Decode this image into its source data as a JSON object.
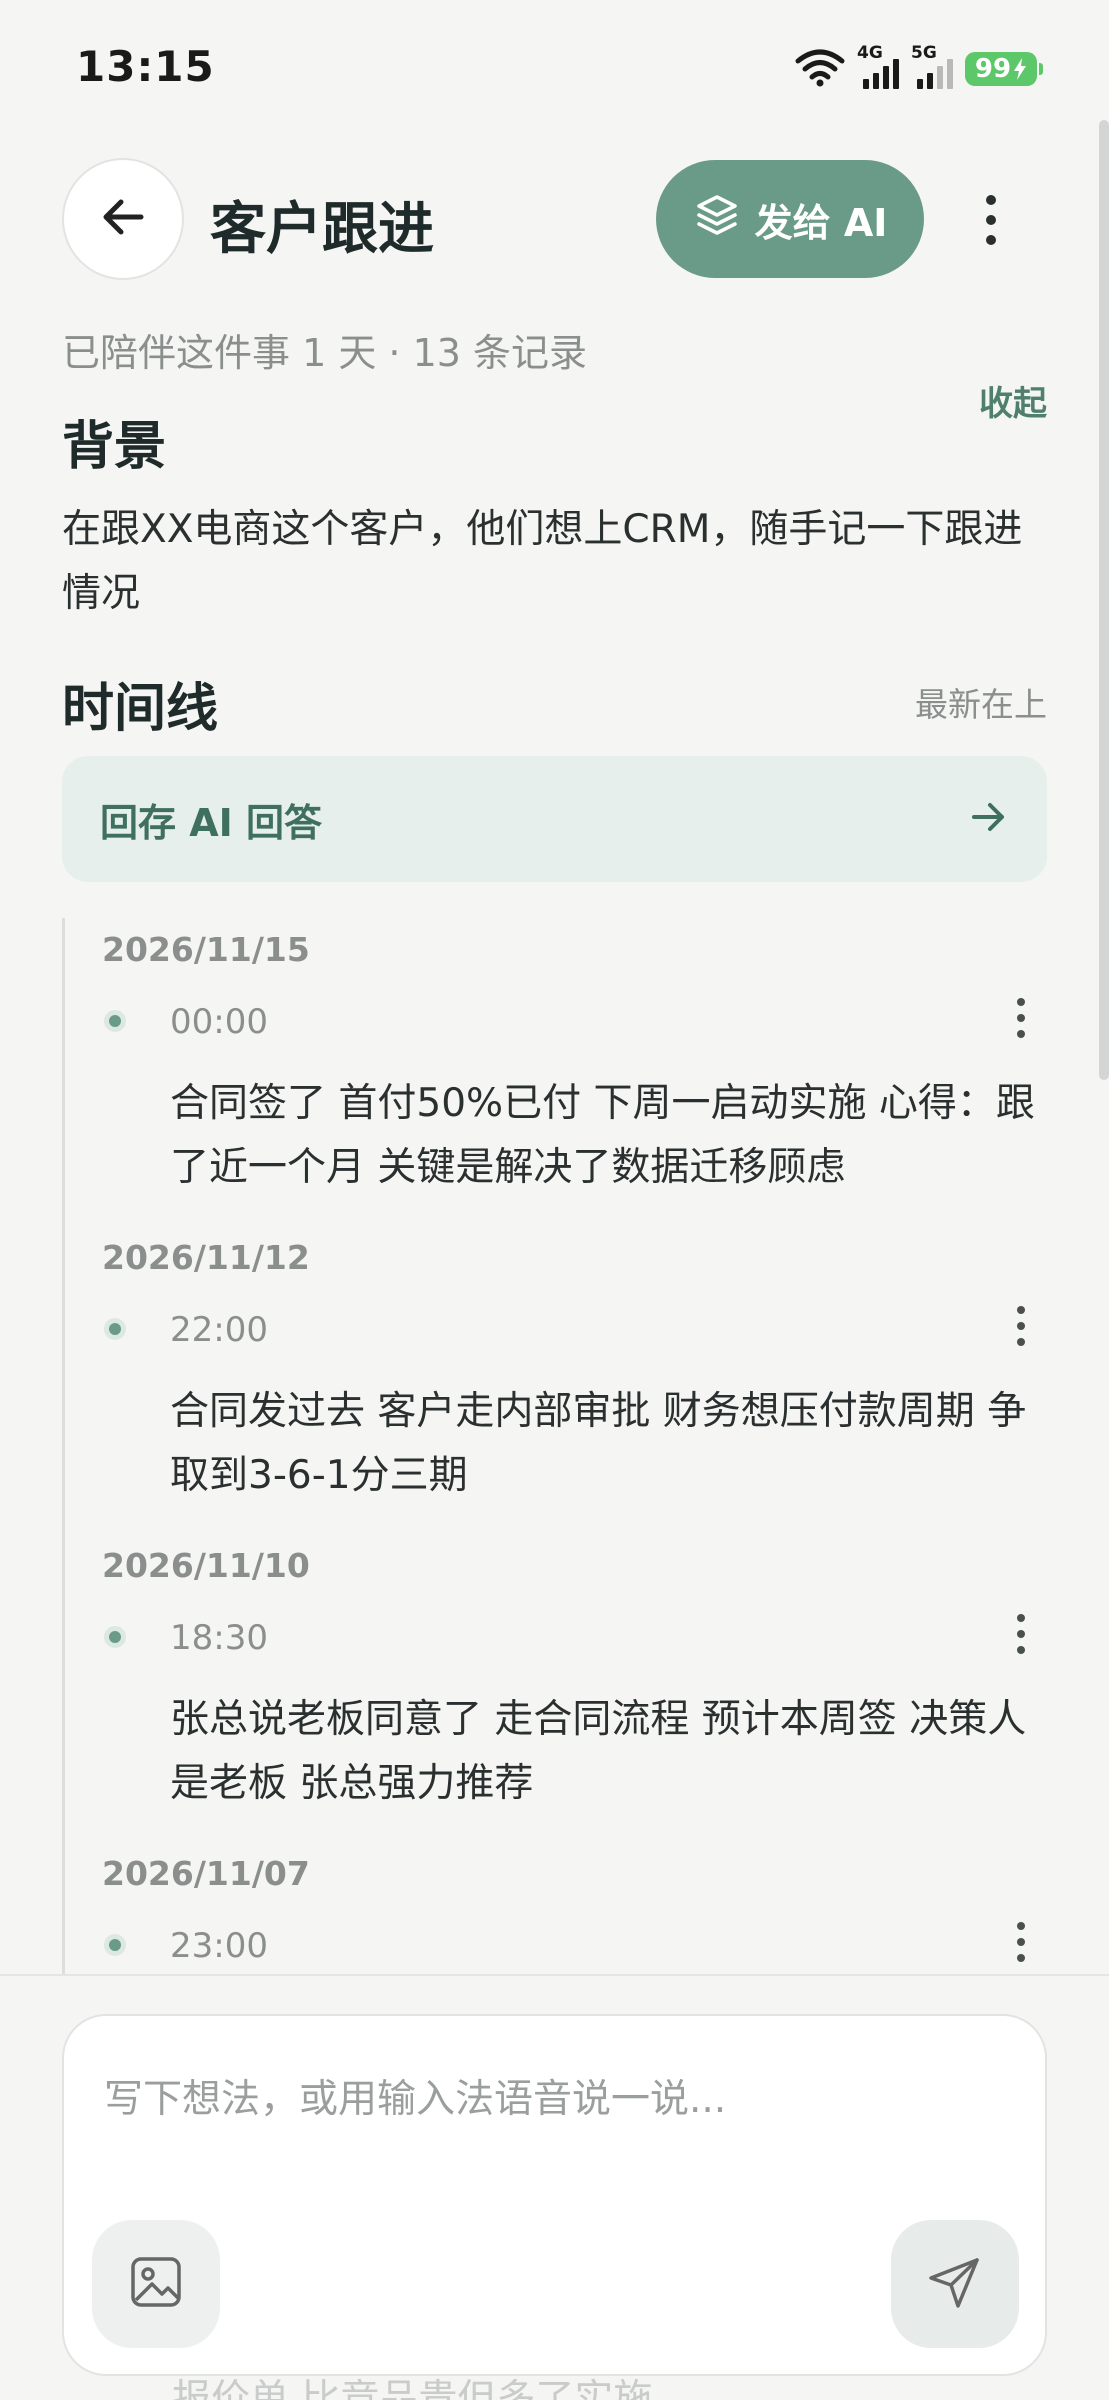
{
  "status_bar": {
    "time": "13:15",
    "network_1": "4G",
    "network_2": "5G",
    "battery": "99"
  },
  "header": {
    "title": "客户跟进",
    "send_ai_label": "发给 AI"
  },
  "meta": "已陪伴这件事 1 天 · 13 条记录",
  "background": {
    "title": "背景",
    "collapse_label": "收起",
    "text": "在跟XX电商这个客户，他们想上CRM，随手记一下跟进情况"
  },
  "timeline": {
    "title": "时间线",
    "sort_hint": "最新在上",
    "save_ai_label": "回存 AI 回答",
    "entries": [
      {
        "date": "2026/11/15",
        "time": "00:00",
        "text": "合同签了 首付50%已付 下周一启动实施 心得：跟了近一个月 关键是解决了数据迁移顾虑"
      },
      {
        "date": "2026/11/12",
        "time": "22:00",
        "text": "合同发过去 客户走内部审批 财务想压付款周期 争取到3-6-1分三期"
      },
      {
        "date": "2026/11/10",
        "time": "18:30",
        "text": "张总说老板同意了 走合同流程 预计本周签 决策人是老板 张总强力推荐"
      },
      {
        "date": "2026/11/07",
        "time": "23:00",
        "text": ""
      }
    ]
  },
  "composer": {
    "placeholder": "写下想法，或用输入法语音说一说...",
    "behind_text": "报价单 比竞品贵但多了实施"
  },
  "colors": {
    "accent": "#6a9b89",
    "accent_dark": "#4f7f6e",
    "card_bg": "#e6efec",
    "page_bg": "#f5f5f4"
  },
  "icons": [
    "back-arrow-icon",
    "layers-icon",
    "more-vertical-icon",
    "arrow-right-icon",
    "image-icon",
    "send-icon",
    "wifi-icon",
    "signal-icon",
    "battery-icon"
  ]
}
